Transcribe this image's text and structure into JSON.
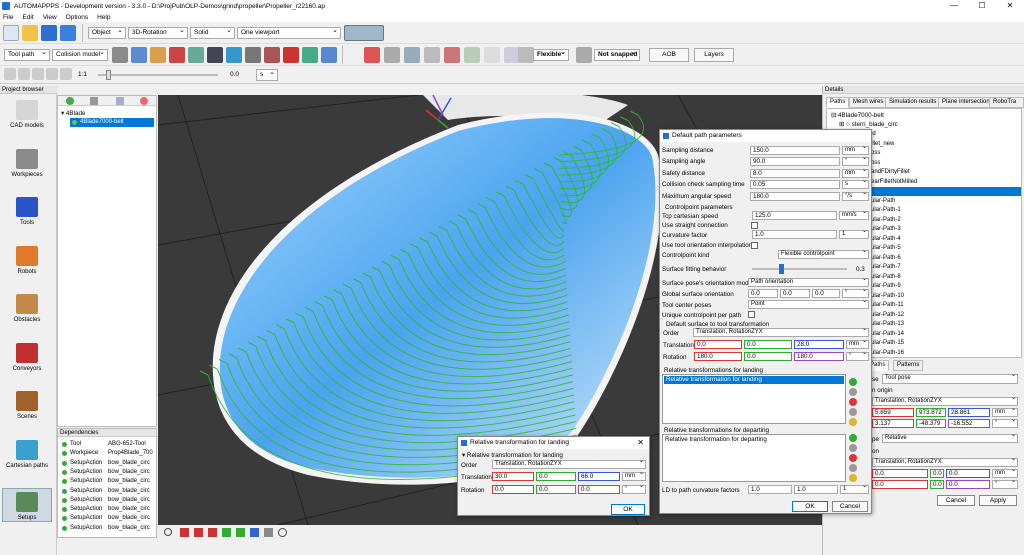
{
  "window": {
    "title": "AUTOMAPPPS - Development version - 3.3.0 - D:\\ProjPub\\OLP-Demos\\grind\\propeller\\Propeller_r22160.ap",
    "controls": [
      "—",
      "☐",
      "✕"
    ]
  },
  "menu": [
    "File",
    "Edit",
    "View",
    "Options",
    "Help"
  ],
  "toolbar1": {
    "object_mode": "Object",
    "rotation_mode": "3D-Rotation",
    "shading": "Solid",
    "viewport_layout": "One viewport"
  },
  "toolbar2": {
    "tool_select": "Tool path",
    "model_select": "Collision model",
    "flexible_select": "Flexible",
    "snap_select": "Not snapped",
    "aob_button": "AOB",
    "layers_button": "Layers"
  },
  "toolbar3": {
    "speed_label": "1:1",
    "time_value": "0.0",
    "time_unit": "s"
  },
  "project_browser": {
    "title": "Project browser",
    "nav": [
      {
        "label": "CAD models",
        "icon": "cad-models-icon"
      },
      {
        "label": "Workpieces",
        "icon": "workpieces-icon"
      },
      {
        "label": "Tools",
        "icon": "tools-icon"
      },
      {
        "label": "Robots",
        "icon": "robots-icon"
      },
      {
        "label": "Obstacles",
        "icon": "obstacles-icon"
      },
      {
        "label": "Conveyors",
        "icon": "conveyors-icon"
      },
      {
        "label": "Scenes",
        "icon": "scenes-icon"
      },
      {
        "label": "Cartesian paths",
        "icon": "cartesian-paths-icon"
      },
      {
        "label": "Setups",
        "icon": "setups-icon"
      }
    ],
    "tree_root": "4Blade",
    "tree_selected": "4Blade7000-belt"
  },
  "dependencies": {
    "title": "Dependencies",
    "rows": [
      {
        "type": "Tool",
        "name": "ABG-652-Tool"
      },
      {
        "type": "Workpiece",
        "name": "Prop4Blade_700"
      },
      {
        "type": "SetupAction",
        "name": "bow_blade_circ"
      },
      {
        "type": "SetupAction",
        "name": "bow_blade_circ"
      },
      {
        "type": "SetupAction",
        "name": "bow_blade_circ"
      },
      {
        "type": "SetupAction",
        "name": "bow_blade_circ"
      },
      {
        "type": "SetupAction",
        "name": "bow_blade_circ"
      },
      {
        "type": "SetupAction",
        "name": "bow_blade_circ"
      },
      {
        "type": "SetupAction",
        "name": "bow_blade_circ"
      },
      {
        "type": "SetupAction",
        "name": "bow_blade_circ"
      }
    ]
  },
  "details": {
    "title": "Details",
    "tabs": [
      "Paths",
      "Mesh wires",
      "Simulation results",
      "Plane intersection",
      "RoboTra"
    ],
    "tree_root": "4Blade7000-belt",
    "tree_child": "stern_blade_circ",
    "tree_items": [
      "ld",
      "illet_new",
      "oss",
      "oss",
      "andFDirtyFillet",
      "earFilletNotMilled",
      "",
      "ular-Path",
      "ular-Path-1",
      "ular-Path-2",
      "ular-Path-3",
      "ular-Path-4",
      "ular-Path-5",
      "ular-Path-6",
      "ular-Path-7",
      "ular-Path-8",
      "ular-Path-9",
      "ular-Path-10",
      "ular-Path-11",
      "ular-Path-12",
      "ular-Path-13",
      "ular-Path-14",
      "ular-Path-15",
      "ular-Path-16"
    ],
    "lower_tabs": [
      "Paths",
      "Patterns"
    ],
    "pose_label": "se",
    "pose_value": "Tool pose",
    "origin_label": "n origin",
    "order_value": "Translation, RotationZYX",
    "translation": [
      "5.859",
      "973.872",
      "28.861"
    ],
    "translation_unit": "mm",
    "rotation": [
      "3.137",
      "-48.379",
      "-16.552"
    ],
    "rotation_unit": "°",
    "type_label": "pe",
    "type_value": "Relative",
    "section2_label": "on",
    "order2_value": "Translation, RotationZYX",
    "trans2": [
      "0.0",
      "0.0",
      "0.0"
    ],
    "trans2_unit": "mm",
    "rot2": [
      "0.0",
      "0.0",
      "0.0"
    ],
    "rot2_unit": "°",
    "cancel": "Cancel",
    "apply": "Apply"
  },
  "default_params": {
    "title": "Default path parameters",
    "sampling_distance": {
      "label": "Sampling distance",
      "value": "150.0",
      "unit": "mm"
    },
    "sampling_angle": {
      "label": "Sampling angle",
      "value": "90.0",
      "unit": "°"
    },
    "safety_distance": {
      "label": "Safety distance",
      "value": "8.0",
      "unit": "mm"
    },
    "collision_time": {
      "label": "Collision check sampling time",
      "value": "0.05",
      "unit": "s"
    },
    "max_angular_speed": {
      "label": "Maximum angular speed",
      "value": "180.0",
      "unit": "°/s"
    },
    "controlpoint_header": "Controlpoint parameters",
    "tcp_speed": {
      "label": "Tcp cartesian speed",
      "value": "125.0",
      "unit": "mm/s"
    },
    "straight_conn": {
      "label": "Use straight connection"
    },
    "curvature_factor": {
      "label": "Curvature factor",
      "value": "1.0",
      "unit": "1"
    },
    "tool_orient_interp": {
      "label": "Use tool orientation interpolation"
    },
    "controlpoint_kind": {
      "label": "Controlpoint kind",
      "value": "Flexible controlpoint"
    },
    "surface_fitting": {
      "label": "Surface fitting behavior",
      "value": "0.3",
      "fraction": 0.3
    },
    "surface_pose_mode": {
      "label": "Surface pose's orientation mode",
      "value": "Path orientation"
    },
    "global_surface_orient": {
      "label": "Global surface orientation",
      "values": [
        "0.0",
        "0.0",
        "0.0"
      ],
      "unit": "°"
    },
    "tool_center_poses": {
      "label": "Tool center poses",
      "value": "Point"
    },
    "unique_cp": {
      "label": "Unique controlpoint per path"
    },
    "surface_to_tool_header": "Default surface to tool transformation",
    "order": {
      "label": "Order",
      "value": "Translation, RotationZYX"
    },
    "translation": {
      "label": "Translation",
      "values": [
        "0.0",
        "0.0",
        "28.0"
      ],
      "unit": "mm"
    },
    "rotation": {
      "label": "Rotation",
      "values": [
        "180.0",
        "0.0",
        "180.0"
      ],
      "unit": "°"
    },
    "landing_header": "Relative transformations for landing",
    "landing_item": "Relative transformation for landing",
    "departing_header": "Relative transformations for departing",
    "departing_item": "Relative transformation for departing",
    "curvature_factors": {
      "label": "LD to path curvature factors",
      "values": [
        "1.0",
        "1.0"
      ],
      "unit": "1"
    },
    "ok": "OK",
    "cancel": "Cancel"
  },
  "landing_dialog": {
    "title": "Relative transformation for landing",
    "header": "Relative transformation for landing",
    "order": {
      "label": "Order",
      "value": "Translation, RotationZYX"
    },
    "translation": {
      "label": "Translation",
      "values": [
        "30.0",
        "0.0",
        "66.0"
      ],
      "unit": "mm"
    },
    "rotation": {
      "label": "Rotation",
      "values": [
        "0.0",
        "0.0",
        "0.0"
      ],
      "unit": "°"
    },
    "ok": "OK"
  },
  "colors": {
    "accent": "#0078d7",
    "path_green": "#2eb82e",
    "blade_blue": "#3a8fd8",
    "x_axis": "#d93636",
    "y_axis": "#2faa2f",
    "z_axis": "#3a55d9",
    "rot_axis": "#9b44c8"
  }
}
